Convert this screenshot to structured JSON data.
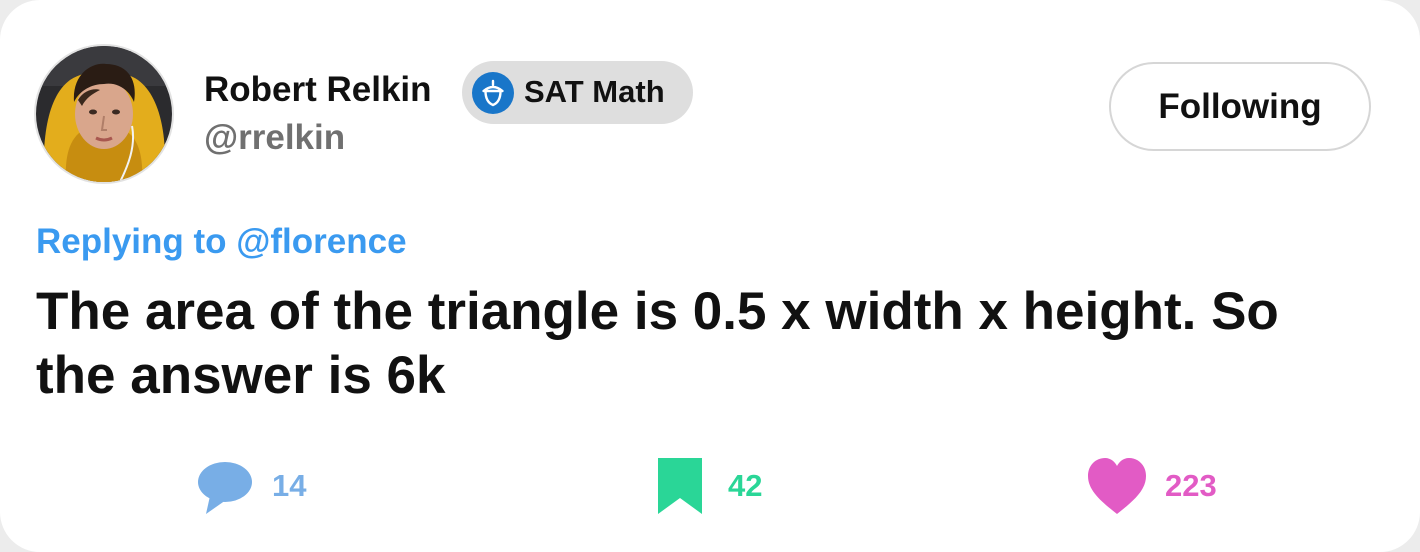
{
  "author": {
    "name": "Robert Relkin",
    "handle": "@rrelkin",
    "avatar_icon": "user-photo-avatar"
  },
  "badge": {
    "label": "SAT Math",
    "icon": "acorn-icon",
    "icon_color": "#1976c9",
    "background": "#dedede"
  },
  "follow_button": {
    "label": "Following"
  },
  "tweet": {
    "replying_to": "Replying to @florence",
    "text": "The area of the triangle is 0.5 x width x height. So the answer is 6k"
  },
  "actions": {
    "comments": {
      "count": "14",
      "icon": "comment-bubble-icon",
      "color": "#78aee6"
    },
    "bookmarks": {
      "count": "42",
      "icon": "bookmark-icon",
      "color": "#2ad697"
    },
    "likes": {
      "count": "223",
      "icon": "heart-icon",
      "color": "#e25bc5"
    }
  },
  "colors": {
    "link": "#3a9af0",
    "text": "#111111",
    "muted": "#707070"
  }
}
